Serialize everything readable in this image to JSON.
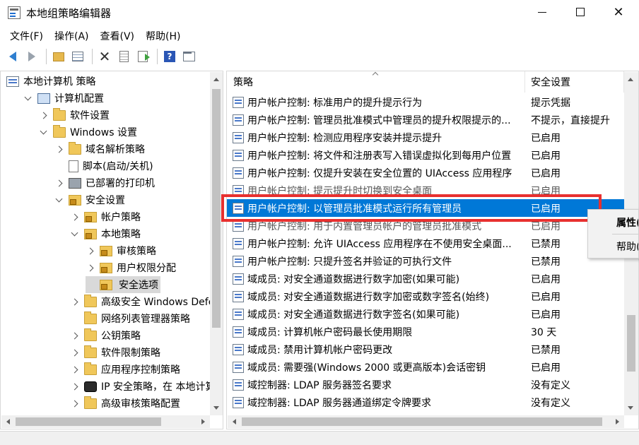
{
  "window": {
    "title": "本地组策略编辑器"
  },
  "menu": [
    "文件(F)",
    "操作(A)",
    "查看(V)",
    "帮助(H)"
  ],
  "tree": [
    {
      "label": "本地计算机 策略",
      "icon": "computer-policy-icon",
      "expander": "none",
      "indent": 0
    },
    {
      "label": "计算机配置",
      "icon": "computer-icon",
      "expander": "down",
      "indent": 1
    },
    {
      "label": "软件设置",
      "icon": "folder-icon",
      "expander": "right",
      "indent": 2
    },
    {
      "label": "Windows 设置",
      "icon": "folder-icon",
      "expander": "down",
      "indent": 2
    },
    {
      "label": "域名解析策略",
      "icon": "folder-icon",
      "expander": "right",
      "indent": 3
    },
    {
      "label": "脚本(启动/关机)",
      "icon": "script-icon",
      "expander": "none",
      "indent": 3
    },
    {
      "label": "已部署的打印机",
      "icon": "printer-icon",
      "expander": "right",
      "indent": 3
    },
    {
      "label": "安全设置",
      "icon": "security-icon",
      "expander": "down",
      "indent": 3
    },
    {
      "label": "帐户策略",
      "icon": "lock-folder-icon",
      "expander": "right",
      "indent": 4
    },
    {
      "label": "本地策略",
      "icon": "lock-folder-icon",
      "expander": "down",
      "indent": 4
    },
    {
      "label": "审核策略",
      "icon": "lock-folder-icon",
      "expander": "right",
      "indent": 5
    },
    {
      "label": "用户权限分配",
      "icon": "lock-folder-icon",
      "expander": "right",
      "indent": 5
    },
    {
      "label": "安全选项",
      "icon": "lock-folder-icon",
      "expander": "none",
      "indent": 5,
      "selected": true
    },
    {
      "label": "高级安全 Windows Defen",
      "icon": "folder-icon",
      "expander": "right",
      "indent": 4
    },
    {
      "label": "网络列表管理器策略",
      "icon": "folder-icon",
      "expander": "none",
      "indent": 4
    },
    {
      "label": "公钥策略",
      "icon": "folder-icon",
      "expander": "right",
      "indent": 4
    },
    {
      "label": "软件限制策略",
      "icon": "folder-icon",
      "expander": "right",
      "indent": 4
    },
    {
      "label": "应用程序控制策略",
      "icon": "folder-icon",
      "expander": "right",
      "indent": 4
    },
    {
      "label": "IP 安全策略，在 本地计算",
      "icon": "ip-security-icon",
      "expander": "right",
      "indent": 4
    },
    {
      "label": "高级审核策略配置",
      "icon": "folder-icon",
      "expander": "right",
      "indent": 4
    }
  ],
  "list": {
    "headers": {
      "policy": "策略",
      "setting": "安全设置"
    },
    "rows": [
      {
        "name": "用户帐户控制: 标准用户的提升提示行为",
        "value": "提示凭据"
      },
      {
        "name": "用户帐户控制: 管理员批准模式中管理员的提升权限提示的...",
        "value": "不提示，直接提升"
      },
      {
        "name": "用户帐户控制: 检测应用程序安装并提示提升",
        "value": "已启用"
      },
      {
        "name": "用户帐户控制: 将文件和注册表写入错误虚拟化到每用户位置",
        "value": "已启用"
      },
      {
        "name": "用户帐户控制: 仅提升安装在安全位置的 UIAccess 应用程序",
        "value": "已启用"
      },
      {
        "name": "用户帐户控制: 提示提升时切换到安全桌面",
        "value": "已启用",
        "partial": true
      },
      {
        "name": "用户帐户控制: 以管理员批准模式运行所有管理员",
        "value": "已启用",
        "selected": true
      },
      {
        "name": "用户帐户控制: 用于内置管理员帐户的管理员批准模式",
        "value": "已启用",
        "partial": true
      },
      {
        "name": "用户帐户控制: 允许 UIAccess 应用程序在不使用安全桌面...",
        "value": "已禁用"
      },
      {
        "name": "用户帐户控制: 只提升签名并验证的可执行文件",
        "value": "已禁用"
      },
      {
        "name": "域成员: 对安全通道数据进行数字加密(如果可能)",
        "value": "已启用"
      },
      {
        "name": "域成员: 对安全通道数据进行数字加密或数字签名(始终)",
        "value": "已启用"
      },
      {
        "name": "域成员: 对安全通道数据进行数字签名(如果可能)",
        "value": "已启用"
      },
      {
        "name": "域成员: 计算机帐户密码最长使用期限",
        "value": "30 天"
      },
      {
        "name": "域成员: 禁用计算机帐户密码更改",
        "value": "已禁用"
      },
      {
        "name": "域成员: 需要强(Windows 2000 或更高版本)会话密钥",
        "value": "已启用"
      },
      {
        "name": "域控制器: LDAP 服务器签名要求",
        "value": "没有定义"
      },
      {
        "name": "域控制器: LDAP 服务器通道绑定令牌要求",
        "value": "没有定义"
      }
    ]
  },
  "context_menu": {
    "properties": "属性(",
    "help": "帮助("
  },
  "colors": {
    "selection": "#0078d7",
    "highlight_box": "#e8302f"
  }
}
